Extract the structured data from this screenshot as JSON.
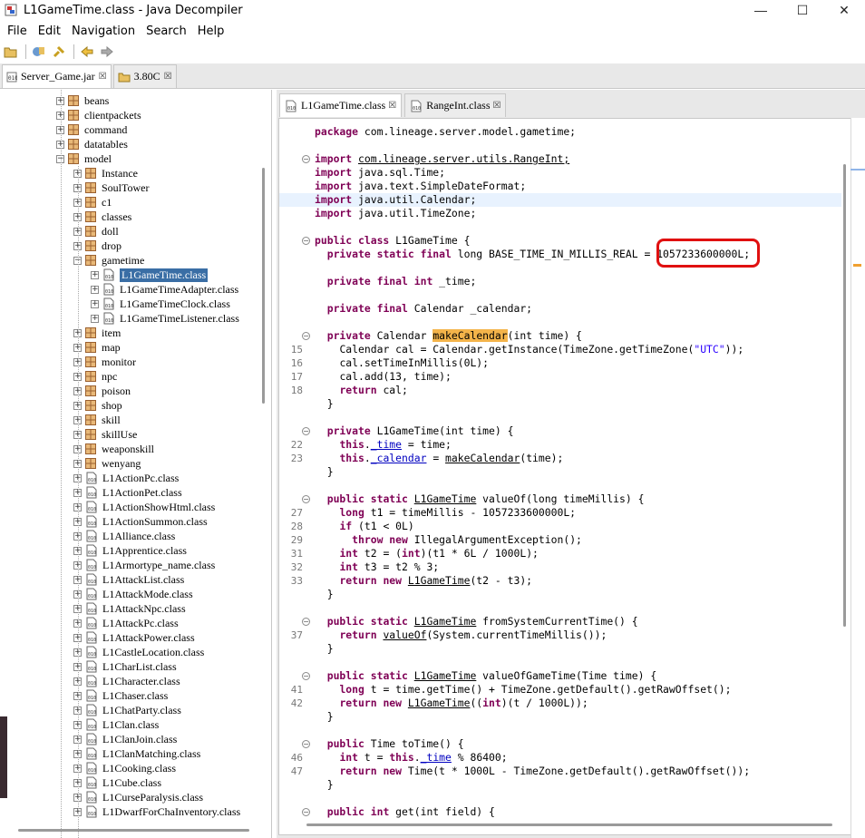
{
  "window": {
    "title": "L1GameTime.class - Java Decompiler",
    "minimize": "—",
    "maximize": "☐",
    "close": "✕"
  },
  "menu": [
    "File",
    "Edit",
    "Navigation",
    "Search",
    "Help"
  ],
  "file_tabs": [
    {
      "label": "Server_Game.jar",
      "active": true
    },
    {
      "label": "3.80C",
      "active": false
    }
  ],
  "code_tabs": [
    {
      "label": "L1GameTime.class",
      "active": true
    },
    {
      "label": "RangeInt.class",
      "active": false
    }
  ],
  "tree": {
    "packages": [
      "beans",
      "clientpackets",
      "command",
      "datatables",
      "model"
    ],
    "model_children": [
      "Instance",
      "SoulTower",
      "c1",
      "classes",
      "doll",
      "drop",
      "gametime"
    ],
    "gametime_children": [
      "L1GameTime.class",
      "L1GameTimeAdapter.class",
      "L1GameTimeClock.class",
      "L1GameTimeListener.class"
    ],
    "selected": "L1GameTime.class",
    "model_children_after": [
      "item",
      "map",
      "monitor",
      "npc",
      "poison",
      "shop",
      "skill",
      "skillUse",
      "weaponskill",
      "wenyang"
    ],
    "model_classes": [
      "L1ActionPc.class",
      "L1ActionPet.class",
      "L1ActionShowHtml.class",
      "L1ActionSummon.class",
      "L1Alliance.class",
      "L1Apprentice.class",
      "L1Armortype_name.class",
      "L1AttackList.class",
      "L1AttackMode.class",
      "L1AttackNpc.class",
      "L1AttackPc.class",
      "L1AttackPower.class",
      "L1CastleLocation.class",
      "L1CharList.class",
      "L1Character.class",
      "L1Chaser.class",
      "L1ChatParty.class",
      "L1Clan.class",
      "L1ClanJoin.class",
      "L1ClanMatching.class",
      "L1Cooking.class",
      "L1Cube.class",
      "L1CurseParalysis.class",
      "L1DwarfForChaInventory.class"
    ]
  },
  "code": {
    "package_line": "com.lineage.server.model.gametime;",
    "imports": [
      "com.lineage.server.utils.RangeInt;",
      "java.sql.Time;",
      "java.text.SimpleDateFormat;",
      "java.util.Calendar;",
      "java.util.TimeZone;"
    ],
    "class_decl": "L1GameTime {",
    "base_time_decl": "long BASE_TIME_IN_MILLIS_REAL = ",
    "base_time_value": "1057233600000L;",
    "time_field": "_time;",
    "calendar_field": "Calendar _calendar;",
    "make_calendar_name": "makeCalendar",
    "make_calendar_rest": "(int time) {",
    "line_numbers": [
      "15",
      "16",
      "17",
      "18",
      "22",
      "23",
      "27",
      "28",
      "29",
      "31",
      "32",
      "33",
      "37",
      "41",
      "42",
      "46",
      "47"
    ],
    "l15": "Calendar cal = Calendar.getInstance(TimeZone.getTimeZone(",
    "l15_str": "\"UTC\"",
    "l15_end": "));",
    "l16": "cal.setTimeInMillis(0L);",
    "l17": "cal.add(13, time);",
    "l18": "cal;",
    "ctor": "L1GameTime(int time) {",
    "l22a": " = time;",
    "l23a": "makeCalendar",
    "l23b": "(time);",
    "valueof_decl": "valueOf(long timeMillis) {",
    "l27": " t1 = timeMillis - 1057233600000L;",
    "l28": " (t1 < 0L)",
    "l29": " IllegalArgumentException();",
    "l31a": " t2 = (",
    "l31b": ")(t1 * 6L / 1000L);",
    "l32": " t3 = t2 % 3;",
    "l33": "(t2 - t3);",
    "fsct_decl": "fromSystemCurrentTime() {",
    "l37a": "valueOf",
    "l37b": "(System.currentTimeMillis());",
    "vogt_decl": "valueOfGameTime(Time time) {",
    "l41": " t = time.getTime() + TimeZone.getDefault().getRawOffset();",
    "l42a": "((",
    "l42b": ")(t / 1000L));",
    "totime_decl": "Time toTime() {",
    "l46a": " t = ",
    "l46b": " % 86400;",
    "l47": " Time(t * 1000L - TimeZone.getDefault().getRawOffset());",
    "get_decl": "get(int field) {"
  }
}
